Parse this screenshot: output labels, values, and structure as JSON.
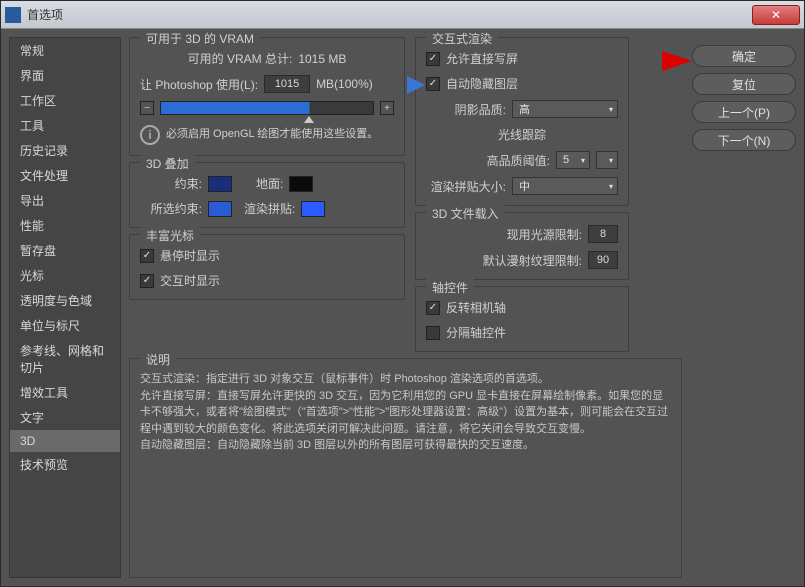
{
  "window": {
    "title": "首选项"
  },
  "sidebar": {
    "items": [
      "常规",
      "界面",
      "工作区",
      "工具",
      "历史记录",
      "文件处理",
      "导出",
      "性能",
      "暂存盘",
      "光标",
      "透明度与色域",
      "单位与标尺",
      "参考线、网格和切片",
      "增效工具",
      "文字",
      "3D",
      "技术预览"
    ],
    "selected": 15
  },
  "buttons": {
    "ok": "确定",
    "reset": "复位",
    "prev": "上一个(P)",
    "next": "下一个(N)"
  },
  "vram": {
    "title": "可用于 3D 的 VRAM",
    "total_label": "可用的 VRAM 总计:",
    "total_value": "1015 MB",
    "use_label": "让 Photoshop 使用(L):",
    "use_value": "1015",
    "unit": "MB(100%)",
    "info": "必须启用 OpenGL 绘图才能使用这些设置。"
  },
  "overlay": {
    "title": "3D 叠加",
    "constraint": "约束:",
    "constraint_color": "#1a2d7a",
    "ground": "地面:",
    "ground_color": "#0a0a0a",
    "sel_constraint": "所选约束:",
    "sel_constraint_color": "#2a5cd4",
    "tile": "渲染拼贴:",
    "tile_color": "#2a5cff"
  },
  "cursor": {
    "title": "丰富光标",
    "hover": "悬停时显示",
    "interact": "交互时显示"
  },
  "render": {
    "title": "交互式渲染",
    "direct": "允许直接写屏",
    "autohide": "自动隐藏图层",
    "shadow_label": "阴影品质:",
    "shadow_value": "高",
    "ray_title": "光线跟踪",
    "hq_label": "高品质阈值:",
    "hq_value": "5",
    "tilesize_label": "渲染拼贴大小:",
    "tilesize_value": "中"
  },
  "fileload": {
    "title": "3D 文件载入",
    "light_label": "现用光源限制:",
    "light_value": "8",
    "tex_label": "默认漫射纹理限制:",
    "tex_value": "90"
  },
  "axis": {
    "title": "轴控件",
    "reverse": "反转相机轴",
    "separate": "分隔轴控件"
  },
  "desc": {
    "title": "说明",
    "text": "交互式渲染：指定进行 3D 对象交互（鼠标事件）时 Photoshop 渲染选项的首选项。\n允许直接写屏：直接写屏允许更快的 3D 交互，因为它利用您的 GPU 显卡直接在屏幕绘制像素。如果您的显卡不够强大，或者将\"绘图模式\"（\"首选项\">\"性能\">\"图形处理器设置：高级\"）设置为基本，则可能会在交互过程中遇到较大的颜色变化。将此选项关闭可解决此问题。请注意，将它关闭会导致交互变慢。\n自动隐藏图层：自动隐藏除当前 3D 图层以外的所有图层可获得最快的交互速度。"
  }
}
